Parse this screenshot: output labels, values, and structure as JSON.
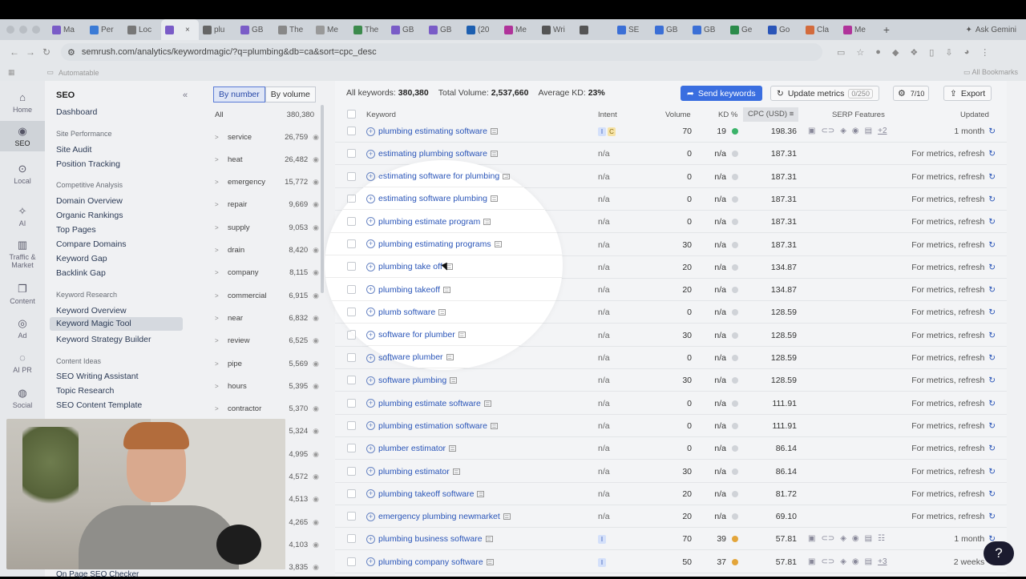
{
  "browser": {
    "tabs": [
      {
        "label": "Ma",
        "color": "#7a5cc7"
      },
      {
        "label": "Per",
        "color": "#3b7bd6"
      },
      {
        "label": "Loc",
        "color": "#777"
      },
      {
        "label": "",
        "color": "#7a5cc7",
        "active": true
      },
      {
        "label": "plu",
        "color": "#666"
      },
      {
        "label": "GB",
        "color": "#7a5cc7"
      },
      {
        "label": "The",
        "color": "#888"
      },
      {
        "label": "Me",
        "color": "#999"
      },
      {
        "label": "The",
        "color": "#3c8a4c"
      },
      {
        "label": "GB",
        "color": "#7a5cc7"
      },
      {
        "label": "GB",
        "color": "#7a5cc7"
      },
      {
        "label": "(20",
        "color": "#1d5fb0"
      },
      {
        "label": "Me",
        "color": "#b0339a"
      },
      {
        "label": "Wri",
        "color": "#555"
      },
      {
        "label": "",
        "color": "#555"
      },
      {
        "label": "SE",
        "color": "#3b6fd6"
      },
      {
        "label": "GB",
        "color": "#3b6fd6"
      },
      {
        "label": "GB",
        "color": "#3b6fd6"
      },
      {
        "label": "Ge",
        "color": "#2b8b4a"
      },
      {
        "label": "Go",
        "color": "#2a55b8"
      },
      {
        "label": "Cla",
        "color": "#d36b3c"
      },
      {
        "label": "Me",
        "color": "#b0339a"
      }
    ],
    "ask_gemini": "Ask Gemini",
    "url": "semrush.com/analytics/keywordmagic/?q=plumbing&db=ca&sort=cpc_desc",
    "bookmark_left": "Automatable",
    "bookmark_right": "All Bookmarks"
  },
  "rail": [
    {
      "label": "Home",
      "icon": "⌂"
    },
    {
      "label": "SEO",
      "icon": "◉",
      "active": true
    },
    {
      "label": "Local",
      "icon": "⊙"
    },
    {
      "label": "AI",
      "icon": "✧"
    },
    {
      "label": "Traffic & Market",
      "icon": "▥"
    },
    {
      "label": "Content",
      "icon": "❐"
    },
    {
      "label": "Ad",
      "icon": "◎"
    },
    {
      "label": "AI PR",
      "icon": "◌"
    },
    {
      "label": "Social",
      "icon": "◍"
    }
  ],
  "menu": {
    "title": "SEO",
    "dashboard": "Dashboard",
    "sec1": "Site Performance",
    "site_audit": "Site Audit",
    "position_tracking": "Position Tracking",
    "sec2": "Competitive Analysis",
    "domain_overview": "Domain Overview",
    "organic_rankings": "Organic Rankings",
    "top_pages": "Top Pages",
    "compare_domains": "Compare Domains",
    "keyword_gap": "Keyword Gap",
    "backlink_gap": "Backlink Gap",
    "sec3": "Keyword Research",
    "keyword_overview": "Keyword Overview",
    "keyword_magic": "Keyword Magic Tool",
    "keyword_strategy": "Keyword Strategy Builder",
    "sec4": "Content Ideas",
    "seo_writing": "SEO Writing Assistant",
    "topic_research": "Topic Research",
    "seo_content": "SEO Content Template",
    "on_page": "On Page SEO Checker"
  },
  "groups": {
    "by_number": "By number",
    "by_volume": "By volume",
    "all_label": "All",
    "all_count": "380,380",
    "items": [
      {
        "name": "service",
        "count": "26,759"
      },
      {
        "name": "heat",
        "count": "26,482"
      },
      {
        "name": "emergency",
        "count": "15,772"
      },
      {
        "name": "repair",
        "count": "9,669"
      },
      {
        "name": "supply",
        "count": "9,053"
      },
      {
        "name": "drain",
        "count": "8,420"
      },
      {
        "name": "company",
        "count": "8,115"
      },
      {
        "name": "commercial",
        "count": "6,915"
      },
      {
        "name": "near",
        "count": "6,832"
      },
      {
        "name": "review",
        "count": "6,525"
      },
      {
        "name": "pipe",
        "count": "5,569"
      },
      {
        "name": "hours",
        "count": "5,395"
      },
      {
        "name": "contractor",
        "count": "5,370"
      },
      {
        "name": "",
        "count": "5,324"
      },
      {
        "name": "",
        "count": "4,995"
      },
      {
        "name": "",
        "count": "4,572"
      },
      {
        "name": "",
        "count": "4,513"
      },
      {
        "name": "",
        "count": "4,265"
      },
      {
        "name": "",
        "count": "4,103"
      },
      {
        "name": "",
        "count": "3,835"
      }
    ]
  },
  "summary": {
    "all_keywords_label": "All keywords:",
    "all_keywords": "380,380",
    "total_volume_label": "Total Volume:",
    "total_volume": "2,537,660",
    "avg_kd_label": "Average KD:",
    "avg_kd": "23%"
  },
  "toolbar": {
    "send": "Send keywords",
    "update": "Update metrics",
    "update_count": "0/250",
    "settings_count": "7/10",
    "export": "Export"
  },
  "headers": {
    "keyword": "Keyword",
    "intent": "Intent",
    "volume": "Volume",
    "kd": "KD %",
    "cpc": "CPC (USD)",
    "serp": "SERP Features",
    "updated": "Updated"
  },
  "rows": [
    {
      "kw": "plumbing estimating software",
      "intent": [
        "I",
        "C"
      ],
      "vol": "70",
      "kd": "19",
      "kdc": "#3bb36a",
      "cpc": "198.36",
      "serp": "+2",
      "upd": "1 month"
    },
    {
      "kw": "estimating plumbing software",
      "intent": "n/a",
      "vol": "0",
      "kd": "n/a",
      "cpc": "187.31",
      "upd": "For metrics, refresh"
    },
    {
      "kw": "estimating software for plumbing",
      "intent": "n/a",
      "vol": "0",
      "kd": "n/a",
      "cpc": "187.31",
      "upd": "For metrics, refresh"
    },
    {
      "kw": "estimating software plumbing",
      "intent": "n/a",
      "vol": "0",
      "kd": "n/a",
      "cpc": "187.31",
      "upd": "For metrics, refresh"
    },
    {
      "kw": "plumbing estimate program",
      "intent": "n/a",
      "vol": "0",
      "kd": "n/a",
      "cpc": "187.31",
      "upd": "For metrics, refresh"
    },
    {
      "kw": "plumbing estimating programs",
      "intent": "n/a",
      "vol": "30",
      "kd": "n/a",
      "cpc": "187.31",
      "upd": "For metrics, refresh"
    },
    {
      "kw": "plumbing take off",
      "intent": "n/a",
      "vol": "20",
      "kd": "n/a",
      "cpc": "134.87",
      "upd": "For metrics, refresh"
    },
    {
      "kw": "plumbing takeoff",
      "intent": "n/a",
      "vol": "20",
      "kd": "n/a",
      "cpc": "134.87",
      "upd": "For metrics, refresh"
    },
    {
      "kw": "plumb software",
      "intent": "n/a",
      "vol": "0",
      "kd": "n/a",
      "cpc": "128.59",
      "upd": "For metrics, refresh"
    },
    {
      "kw": "software for plumber",
      "intent": "n/a",
      "vol": "30",
      "kd": "n/a",
      "cpc": "128.59",
      "upd": "For metrics, refresh"
    },
    {
      "kw": "software plumber",
      "intent": "n/a",
      "vol": "0",
      "kd": "n/a",
      "cpc": "128.59",
      "upd": "For metrics, refresh"
    },
    {
      "kw": "software plumbing",
      "intent": "n/a",
      "vol": "30",
      "kd": "n/a",
      "cpc": "128.59",
      "upd": "For metrics, refresh"
    },
    {
      "kw": "plumbing estimate software",
      "intent": "n/a",
      "vol": "0",
      "kd": "n/a",
      "cpc": "111.91",
      "upd": "For metrics, refresh"
    },
    {
      "kw": "plumbing estimation software",
      "intent": "n/a",
      "vol": "0",
      "kd": "n/a",
      "cpc": "111.91",
      "upd": "For metrics, refresh"
    },
    {
      "kw": "plumber estimator",
      "intent": "n/a",
      "vol": "0",
      "kd": "n/a",
      "cpc": "86.14",
      "upd": "For metrics, refresh"
    },
    {
      "kw": "plumbing estimator",
      "intent": "n/a",
      "vol": "30",
      "kd": "n/a",
      "cpc": "86.14",
      "upd": "For metrics, refresh"
    },
    {
      "kw": "plumbing takeoff software",
      "intent": "n/a",
      "vol": "20",
      "kd": "n/a",
      "cpc": "81.72",
      "upd": "For metrics, refresh"
    },
    {
      "kw": "emergency plumbing newmarket",
      "intent": "n/a",
      "vol": "20",
      "kd": "n/a",
      "cpc": "69.10",
      "upd": "For metrics, refresh"
    },
    {
      "kw": "plumbing business software",
      "intent": [
        "I"
      ],
      "vol": "70",
      "kd": "39",
      "kdc": "#e3a53a",
      "cpc": "57.81",
      "serp": "",
      "upd": "1 month"
    },
    {
      "kw": "plumbing company software",
      "intent": [
        "I"
      ],
      "vol": "50",
      "kd": "37",
      "kdc": "#e3a53a",
      "cpc": "57.81",
      "serp": "+3",
      "upd": "2 weeks"
    }
  ],
  "colors": {
    "accent": "#3a6ee0",
    "kd_green": "#3bb36a",
    "kd_orange": "#e3a53a",
    "link": "#2a55b8"
  },
  "help_label": "?"
}
